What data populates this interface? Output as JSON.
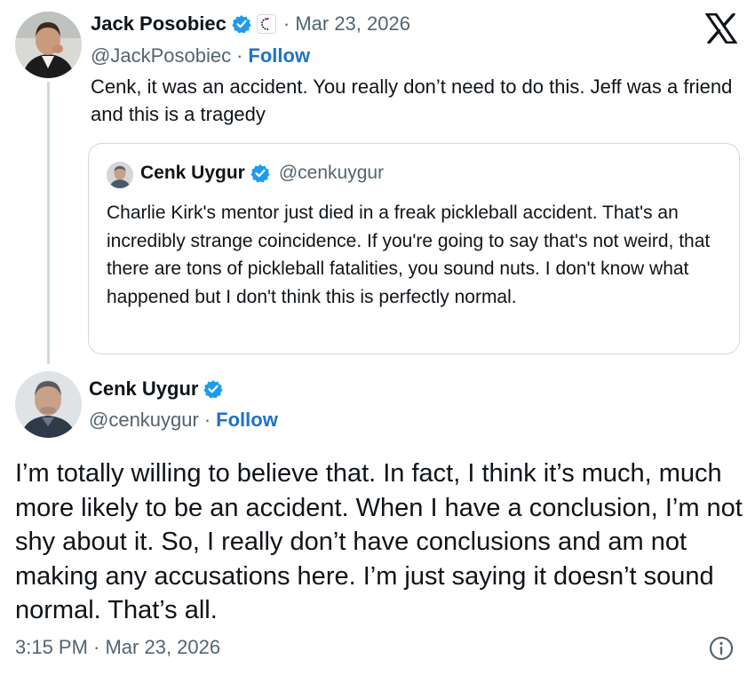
{
  "reply": {
    "author_name": "Jack Posobiec",
    "date": "· Mar 23, 2026",
    "handle": "@JackPosobiec",
    "separator": "·",
    "follow_label": "Follow",
    "text": "Cenk, it was an accident. You really don’t need to do this. Jeff was a friend and this is a tragedy"
  },
  "quote": {
    "author_name": "Cenk Uygur",
    "handle": "@cenkuygur",
    "text": "Charlie Kirk's mentor just died in a freak pickleball accident. That's an incredibly strange coincidence. If you're going to say that's not weird, that there are tons of pickleball fatalities, you sound nuts. I don't know what happened but I don't think this is perfectly normal."
  },
  "main": {
    "author_name": "Cenk Uygur",
    "handle": "@cenkuygur",
    "separator": "·",
    "follow_label": "Follow",
    "text": "I’m totally willing to believe that. In fact, I think it’s much, much more likely to be an accident. When I have a conclusion, I’m not shy about it. So, I really don’t have conclusions and am not making any accusations here. I’m just saying it doesn’t sound normal. That’s all.",
    "timestamp": "3:15 PM · Mar 23, 2026"
  },
  "icons": {
    "brand": "x-logo-icon",
    "verified": "verified-badge-icon",
    "affiliate": "affiliate-badge-icon",
    "info": "info-icon"
  },
  "colors": {
    "text": "#0f1419",
    "muted": "#536471",
    "link": "#1d73c8",
    "verified": "#1d9bf0",
    "border": "#cfd9de"
  }
}
